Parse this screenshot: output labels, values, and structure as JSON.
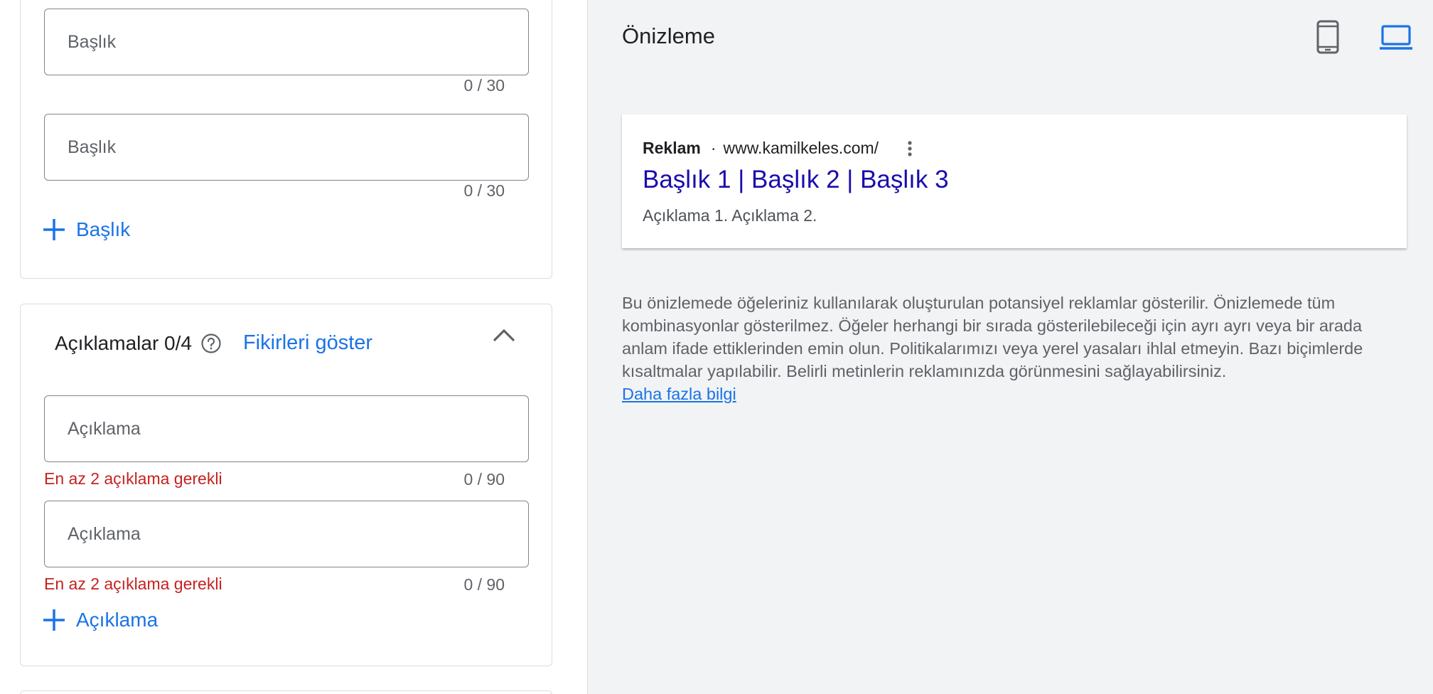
{
  "headlines": {
    "fields": [
      {
        "placeholder": "Başlık",
        "value": "",
        "counter": "0 / 30"
      },
      {
        "placeholder": "Başlık",
        "value": "",
        "counter": "0 / 30"
      }
    ],
    "add_label": "Başlık"
  },
  "descriptions": {
    "title": "Açıklamalar 0/4",
    "ideas_label": "Fikirleri göster",
    "fields": [
      {
        "placeholder": "Açıklama",
        "value": "",
        "counter": "0 / 90",
        "error": "En az 2 açıklama gerekli"
      },
      {
        "placeholder": "Açıklama",
        "value": "",
        "counter": "0 / 90",
        "error": "En az 2 açıklama gerekli"
      }
    ],
    "add_label": "Açıklama"
  },
  "preview": {
    "title": "Önizleme",
    "ad": {
      "label": "Reklam",
      "separator": "·",
      "url": "www.kamilkeles.com/",
      "headline": "Başlık 1 | Başlık 2 | Başlık 3",
      "description": "Açıklama 1. Açıklama 2."
    },
    "info_text": "Bu önizlemede öğeleriniz kullanılarak oluşturulan potansiyel reklamlar gösterilir. Önizlemede tüm kombinasyonlar gösterilmez. Öğeler herhangi bir sırada gösterilebileceği için ayrı ayrı veya bir arada anlam ifade ettiklerinden emin olun. Politikalarımızı veya yerel yasaları ihlal etmeyin. Bazı biçimlerde kısaltmalar yapılabilir. Belirli metinlerin reklamınızda görünmesini sağlayabilirsiniz.",
    "learn_more": "Daha fazla bilgi"
  },
  "icons": {
    "mobile": "smartphone-icon",
    "desktop": "laptop-icon",
    "help": "help-circle-icon",
    "collapse": "chevron-up-icon",
    "add": "plus-icon",
    "more": "more-vert-icon"
  },
  "colors": {
    "accent": "#1a73e8",
    "error": "#c5221f",
    "ad_headline": "#1a0dab",
    "preview_bg": "#f1f3f4"
  }
}
